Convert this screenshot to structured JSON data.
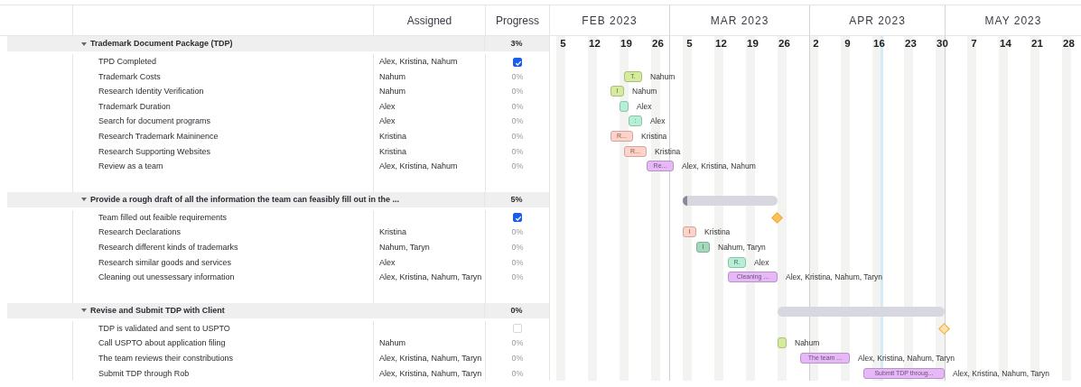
{
  "columns": {
    "assigned": "Assigned",
    "progress": "Progress"
  },
  "timeline": {
    "months": [
      "FEB 2023",
      "MAR 2023",
      "APR 2023",
      "MAY 2023"
    ],
    "weeks": [
      "5",
      "12",
      "19",
      "26",
      "5",
      "12",
      "19",
      "26",
      "2",
      "9",
      "16",
      "23",
      "30",
      "7",
      "14",
      "21",
      "28"
    ]
  },
  "groups": [
    {
      "name": "Trademark Document Package (TDP)",
      "expanded": true,
      "progress": "3%",
      "tasks": [
        {
          "kind": "milestone",
          "name": "TPD Completed",
          "assigned": "Alex, Kristina, Nahum",
          "checked": true
        },
        {
          "kind": "task",
          "name": "Trademark Costs",
          "assigned": "Nahum",
          "progress": "0%",
          "bar": {
            "color": "#d5ec9c",
            "label": "T.",
            "side_label": "Nahum"
          }
        },
        {
          "kind": "task",
          "name": "Research Identity Verification",
          "assigned": "Nahum",
          "progress": "0%",
          "bar": {
            "color": "#d5ec9c",
            "label": "I",
            "side_label": "Nahum"
          }
        },
        {
          "kind": "task",
          "name": "Trademark Duration",
          "assigned": "Alex",
          "progress": "0%",
          "bar": {
            "color": "#b5f0d6",
            "side_label": "Alex"
          }
        },
        {
          "kind": "task",
          "name": "Search for document programs",
          "assigned": "Alex",
          "progress": "0%",
          "bar": {
            "color": "#b5f0d6",
            "label": ":",
            "side_label": "Alex"
          }
        },
        {
          "kind": "task",
          "name": "Research Trademark Maininence",
          "assigned": "Kristina",
          "progress": "0%",
          "bar": {
            "color": "#ffd2c8",
            "label": "R...",
            "side_label": "Kristina"
          }
        },
        {
          "kind": "task",
          "name": "Research Supporting Websites",
          "assigned": "Kristina",
          "progress": "0%",
          "bar": {
            "color": "#ffd2c8",
            "label": "R...",
            "side_label": "Kristina"
          }
        },
        {
          "kind": "task",
          "name": "Review as a team",
          "assigned": "Alex, Kristina, Nahum",
          "progress": "0%",
          "bar": {
            "color": "#e6b8f8",
            "label": "Re...",
            "side_label": "Alex, Kristina, Nahum"
          }
        }
      ]
    },
    {
      "name": "Provide a rough draft of all the information the team can feasibly fill out in the ...",
      "expanded": true,
      "progress": "5%",
      "bar": {
        "level": 0.05
      },
      "tasks": [
        {
          "kind": "milestone",
          "name": "Team filled out feaible requirements",
          "checked": true
        },
        {
          "kind": "task",
          "name": "Research Declarations",
          "assigned": "Kristina",
          "progress": "0%",
          "bar": {
            "color": "#ffd2c8",
            "label": "I",
            "side_label": "Kristina"
          }
        },
        {
          "kind": "task",
          "name": "Research different kinds of trademarks",
          "assigned": "Nahum, Taryn",
          "progress": "0%",
          "bar": {
            "color": "#a2d9bb",
            "label": "I",
            "side_label": "Nahum, Taryn"
          }
        },
        {
          "kind": "task",
          "name": "Research similar goods and services",
          "assigned": "Alex",
          "progress": "0%",
          "bar": {
            "color": "#b5f0d6",
            "label": "R.",
            "side_label": "Alex"
          }
        },
        {
          "kind": "task",
          "name": "Cleaning out unessessary information",
          "assigned": "Alex, Kristina, Nahum, Taryn",
          "progress": "0%",
          "bar": {
            "color": "#e6b8f8",
            "label": "Cleaning ...",
            "side_label": "Alex, Kristina, Nahum, Taryn"
          }
        }
      ]
    },
    {
      "name": "Revise and Submit TDP with Client",
      "expanded": true,
      "progress": "0%",
      "tasks": [
        {
          "kind": "milestone",
          "name": "TDP is validated and sent to USPTO",
          "checked": false
        },
        {
          "kind": "task",
          "name": "Call USPTO about application filing",
          "assigned": "Nahum",
          "progress": "0%",
          "bar": {
            "color": "#d5ec9c",
            "side_label": "Nahum"
          }
        },
        {
          "kind": "task",
          "name": "The team reviews their constributions",
          "assigned": "Alex, Kristina, Nahum, Taryn",
          "progress": "0%",
          "bar": {
            "color": "#e6b8f8",
            "label": "The team ...",
            "side_label": "Alex, Kristina, Nahum, Taryn"
          }
        },
        {
          "kind": "task",
          "name": "Submit TDP through Rob",
          "assigned": "Alex, Kristina, Nahum, Taryn",
          "progress": "0%",
          "bar": {
            "color": "#e6b8f8",
            "label": "Submit TDP throug...",
            "side_label": "Alex, Kristina, Nahum, Taryn"
          }
        }
      ]
    }
  ]
}
